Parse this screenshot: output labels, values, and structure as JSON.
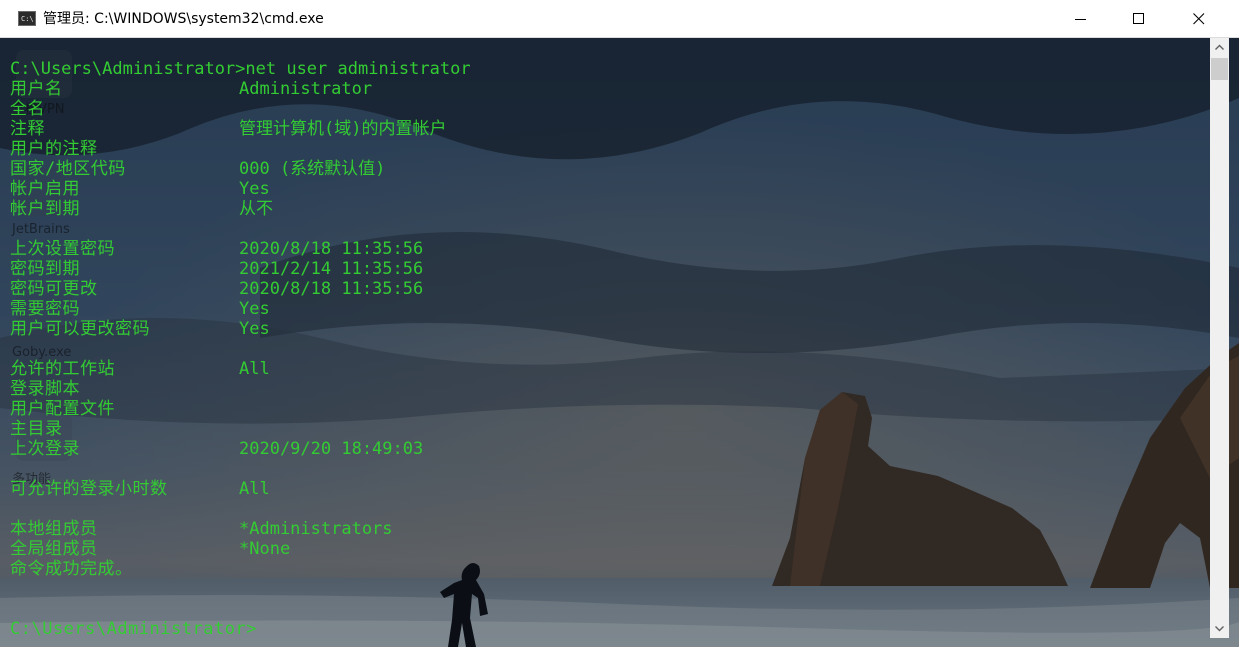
{
  "window": {
    "title": "管理员: C:\\WINDOWS\\system32\\cmd.exe",
    "icon": "cmd-icon",
    "icon_glyph": "C:\\"
  },
  "caption_buttons": {
    "minimize_icon": "minimize-icon",
    "maximize_icon": "maximize-icon",
    "close_icon": "close-icon"
  },
  "desktop_ghost_labels": [
    "全橙VPN",
    "JetBrains",
    "Goby.exe",
    "多功能"
  ],
  "console": {
    "prompt_command": "C:\\Users\\Administrator>net user administrator",
    "rows": [
      {
        "label": "用户名",
        "value": "Administrator"
      },
      {
        "label": "全名",
        "value": ""
      },
      {
        "label": "注释",
        "value": "管理计算机(域)的内置帐户"
      },
      {
        "label": "用户的注释",
        "value": ""
      },
      {
        "label": "国家/地区代码",
        "value": "000 (系统默认值)"
      },
      {
        "label": "帐户启用",
        "value": "Yes"
      },
      {
        "label": "帐户到期",
        "value": "从不"
      },
      {
        "label": "",
        "value": ""
      },
      {
        "label": "上次设置密码",
        "value": "2020/8/18 11:35:56"
      },
      {
        "label": "密码到期",
        "value": "2021/2/14 11:35:56"
      },
      {
        "label": "密码可更改",
        "value": "2020/8/18 11:35:56"
      },
      {
        "label": "需要密码",
        "value": "Yes"
      },
      {
        "label": "用户可以更改密码",
        "value": "Yes"
      },
      {
        "label": "",
        "value": ""
      },
      {
        "label": "允许的工作站",
        "value": "All"
      },
      {
        "label": "登录脚本",
        "value": ""
      },
      {
        "label": "用户配置文件",
        "value": ""
      },
      {
        "label": "主目录",
        "value": ""
      },
      {
        "label": "上次登录",
        "value": "2020/9/20 18:49:03"
      },
      {
        "label": "",
        "value": ""
      },
      {
        "label": "可允许的登录小时数",
        "value": "All"
      },
      {
        "label": "",
        "value": ""
      },
      {
        "label": "本地组成员",
        "value": "*Administrators"
      },
      {
        "label": "全局组成员",
        "value": "*None"
      },
      {
        "label": "命令成功完成。",
        "value": ""
      },
      {
        "label": "",
        "value": ""
      },
      {
        "label": "",
        "value": ""
      },
      {
        "label": "C:\\Users\\Administrator>",
        "value": ""
      }
    ]
  },
  "scrollbar": {
    "up_icon": "scroll-up-arrow-icon",
    "down_icon": "scroll-down-arrow-icon"
  },
  "colors": {
    "console_text": "#33cc33",
    "titlebar_bg": "#ffffff",
    "scrollbar_bg": "#f0f0f0",
    "scrollbar_thumb": "#cdcdcd"
  }
}
